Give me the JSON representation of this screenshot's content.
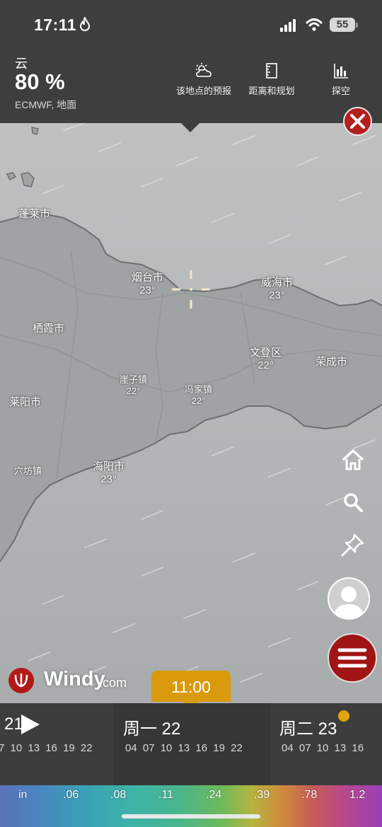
{
  "status_bar": {
    "time": "17:11",
    "battery": "55"
  },
  "header": {
    "layer_name": "云",
    "layer_value": "80 %",
    "model_source": "ECMWF, 地面",
    "actions": [
      {
        "label": "该地点的预报",
        "icon": "cloud-sun-icon"
      },
      {
        "label": "距离和规划",
        "icon": "ruler-icon"
      },
      {
        "label": "探空",
        "icon": "bar-chart-icon"
      }
    ]
  },
  "map": {
    "cities": [
      {
        "name": "蓬莱市",
        "temp": ""
      },
      {
        "name": "烟台市",
        "temp": "23°"
      },
      {
        "name": "威海市",
        "temp": "23°"
      },
      {
        "name": "栖霞市",
        "temp": ""
      },
      {
        "name": "文登区",
        "temp": "22°"
      },
      {
        "name": "荣成市",
        "temp": ""
      },
      {
        "name": "崖子镇",
        "temp": "22°"
      },
      {
        "name": "冯家镇",
        "temp": "22°"
      },
      {
        "name": "莱阳市",
        "temp": ""
      },
      {
        "name": "穴坊镇",
        "temp": ""
      },
      {
        "name": "海阳市",
        "temp": "23°"
      }
    ]
  },
  "brand": {
    "name": "Windy",
    "suffix": ".com"
  },
  "timeline": {
    "selected_time": "11:00",
    "days": [
      {
        "label": "21",
        "hours": "7 10 13 16 19 22"
      },
      {
        "label": "周一 22",
        "hours": "04 07 10 13 16 19 22"
      },
      {
        "label": "周二 23",
        "hours": "04 07 10 13 16"
      }
    ]
  },
  "legend": {
    "unit": "in",
    "values": [
      ".06",
      ".08",
      ".11",
      ".24",
      ".39",
      ".78",
      "1.2"
    ]
  }
}
